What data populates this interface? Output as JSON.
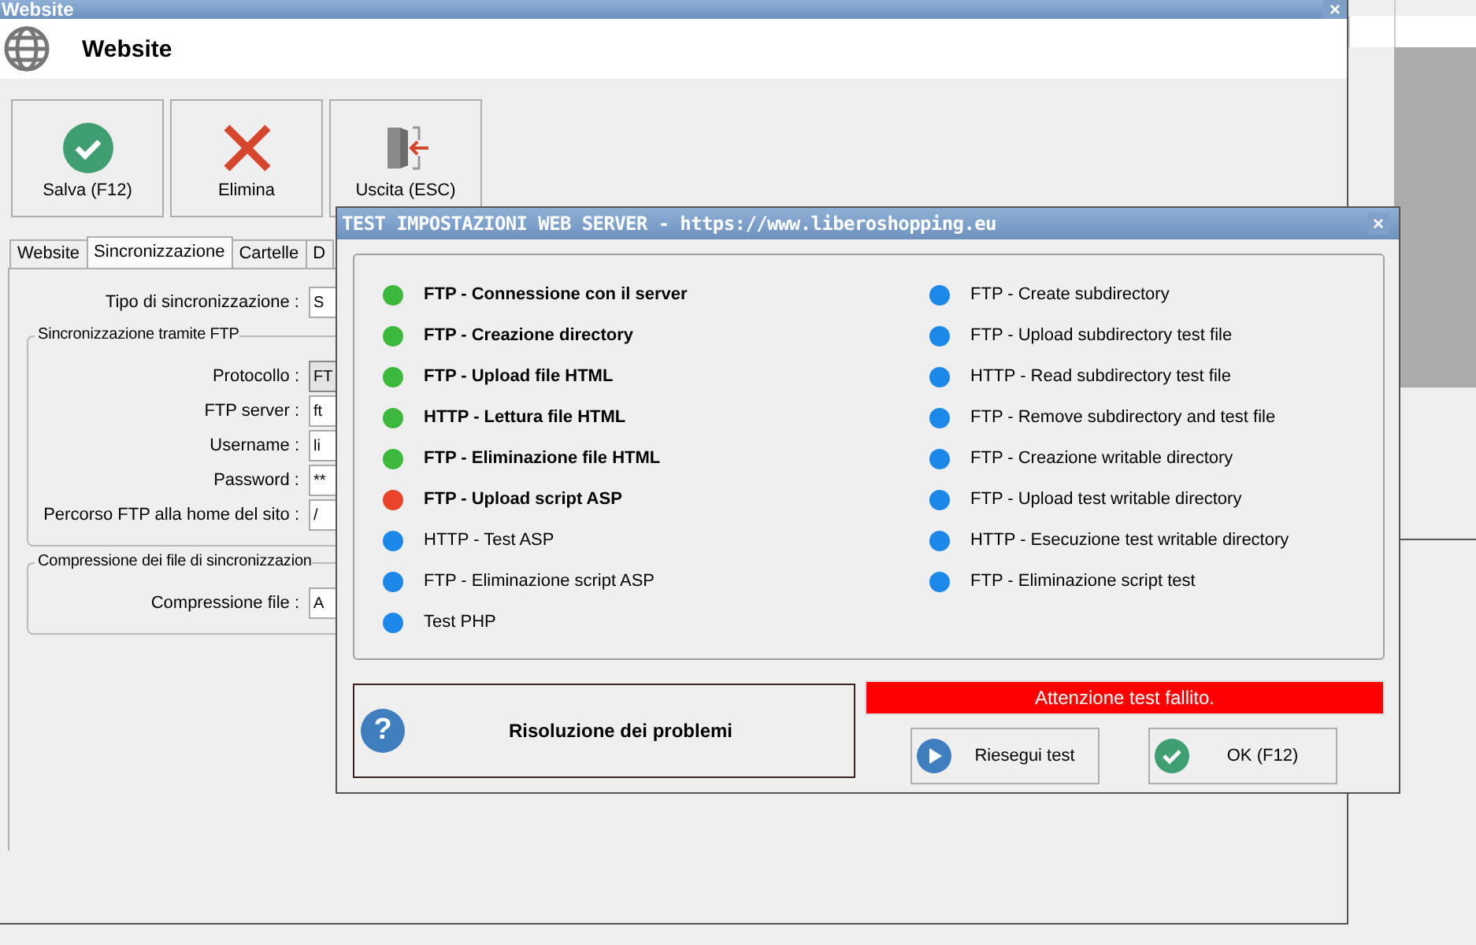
{
  "main_window": {
    "title": "Website",
    "close": "×",
    "header": {
      "title": "Website"
    },
    "toolbar": [
      {
        "kind": "save",
        "label": "Salva (F12)"
      },
      {
        "kind": "delete",
        "label": "Elimina"
      },
      {
        "kind": "exit",
        "label": "Uscita (ESC)"
      }
    ],
    "tabs": [
      {
        "label": "Website",
        "selected": false
      },
      {
        "label": "Sincronizzazione",
        "selected": true
      },
      {
        "label": "Cartelle",
        "selected": false
      },
      {
        "label": "D",
        "selected": false
      }
    ],
    "sync_type": {
      "label": "Tipo di sincronizzazione :",
      "value": "S"
    },
    "ftp_group": {
      "title": "Sincronizzazione tramite FTP",
      "fields": [
        {
          "label": "Protocollo :",
          "value": "FT",
          "disabled": true
        },
        {
          "label": "FTP server :",
          "value": "ft",
          "disabled": false
        },
        {
          "label": "Username :",
          "value": "li",
          "disabled": false
        },
        {
          "label": "Password :",
          "value": "**",
          "disabled": false
        },
        {
          "label": "Percorso FTP alla home del sito :",
          "value": "/",
          "disabled": false
        }
      ]
    },
    "compression_group": {
      "title": "Compressione dei file di sincronizzazion",
      "fields": [
        {
          "label": "Compressione file :",
          "value": "A",
          "disabled": false
        }
      ]
    }
  },
  "dialog": {
    "title": "TEST IMPOSTAZIONI WEB SERVER - https://www.liberoshopping.eu",
    "close": "×",
    "tests_left": [
      {
        "label": "FTP - Connessione con il server",
        "color": "#3cb93c",
        "bold": true
      },
      {
        "label": "FTP - Creazione directory",
        "color": "#3cb93c",
        "bold": true
      },
      {
        "label": "FTP - Upload file HTML",
        "color": "#3cb93c",
        "bold": true
      },
      {
        "label": "HTTP - Lettura file HTML",
        "color": "#3cb93c",
        "bold": true
      },
      {
        "label": "FTP - Eliminazione file HTML",
        "color": "#3cb93c",
        "bold": true
      },
      {
        "label": "FTP - Upload script ASP",
        "color": "#e8452a",
        "bold": true
      },
      {
        "label": "HTTP - Test ASP",
        "color": "#1e88e8",
        "bold": false
      },
      {
        "label": "FTP - Eliminazione script ASP",
        "color": "#1e88e8",
        "bold": false
      },
      {
        "label": "Test PHP",
        "color": "#1e88e8",
        "bold": false
      }
    ],
    "tests_right": [
      {
        "label": "FTP - Create subdirectory",
        "color": "#1e88e8",
        "bold": false
      },
      {
        "label": "FTP - Upload subdirectory test file",
        "color": "#1e88e8",
        "bold": false
      },
      {
        "label": "HTTP - Read subdirectory test file",
        "color": "#1e88e8",
        "bold": false
      },
      {
        "label": "FTP - Remove subdirectory and test file",
        "color": "#1e88e8",
        "bold": false
      },
      {
        "label": "FTP - Creazione writable directory",
        "color": "#1e88e8",
        "bold": false
      },
      {
        "label": "FTP - Upload test writable directory",
        "color": "#1e88e8",
        "bold": false
      },
      {
        "label": "HTTP - Esecuzione test writable directory",
        "color": "#1e88e8",
        "bold": false
      },
      {
        "label": "FTP - Eliminazione script test",
        "color": "#1e88e8",
        "bold": false
      }
    ],
    "help_button": {
      "label": "Risoluzione dei problemi",
      "icon": "?"
    },
    "status_message": "Attenzione test fallito.",
    "buttons": [
      {
        "kind": "rerun",
        "label": "Riesegui test"
      },
      {
        "kind": "ok",
        "label": "OK (F12)"
      }
    ]
  }
}
